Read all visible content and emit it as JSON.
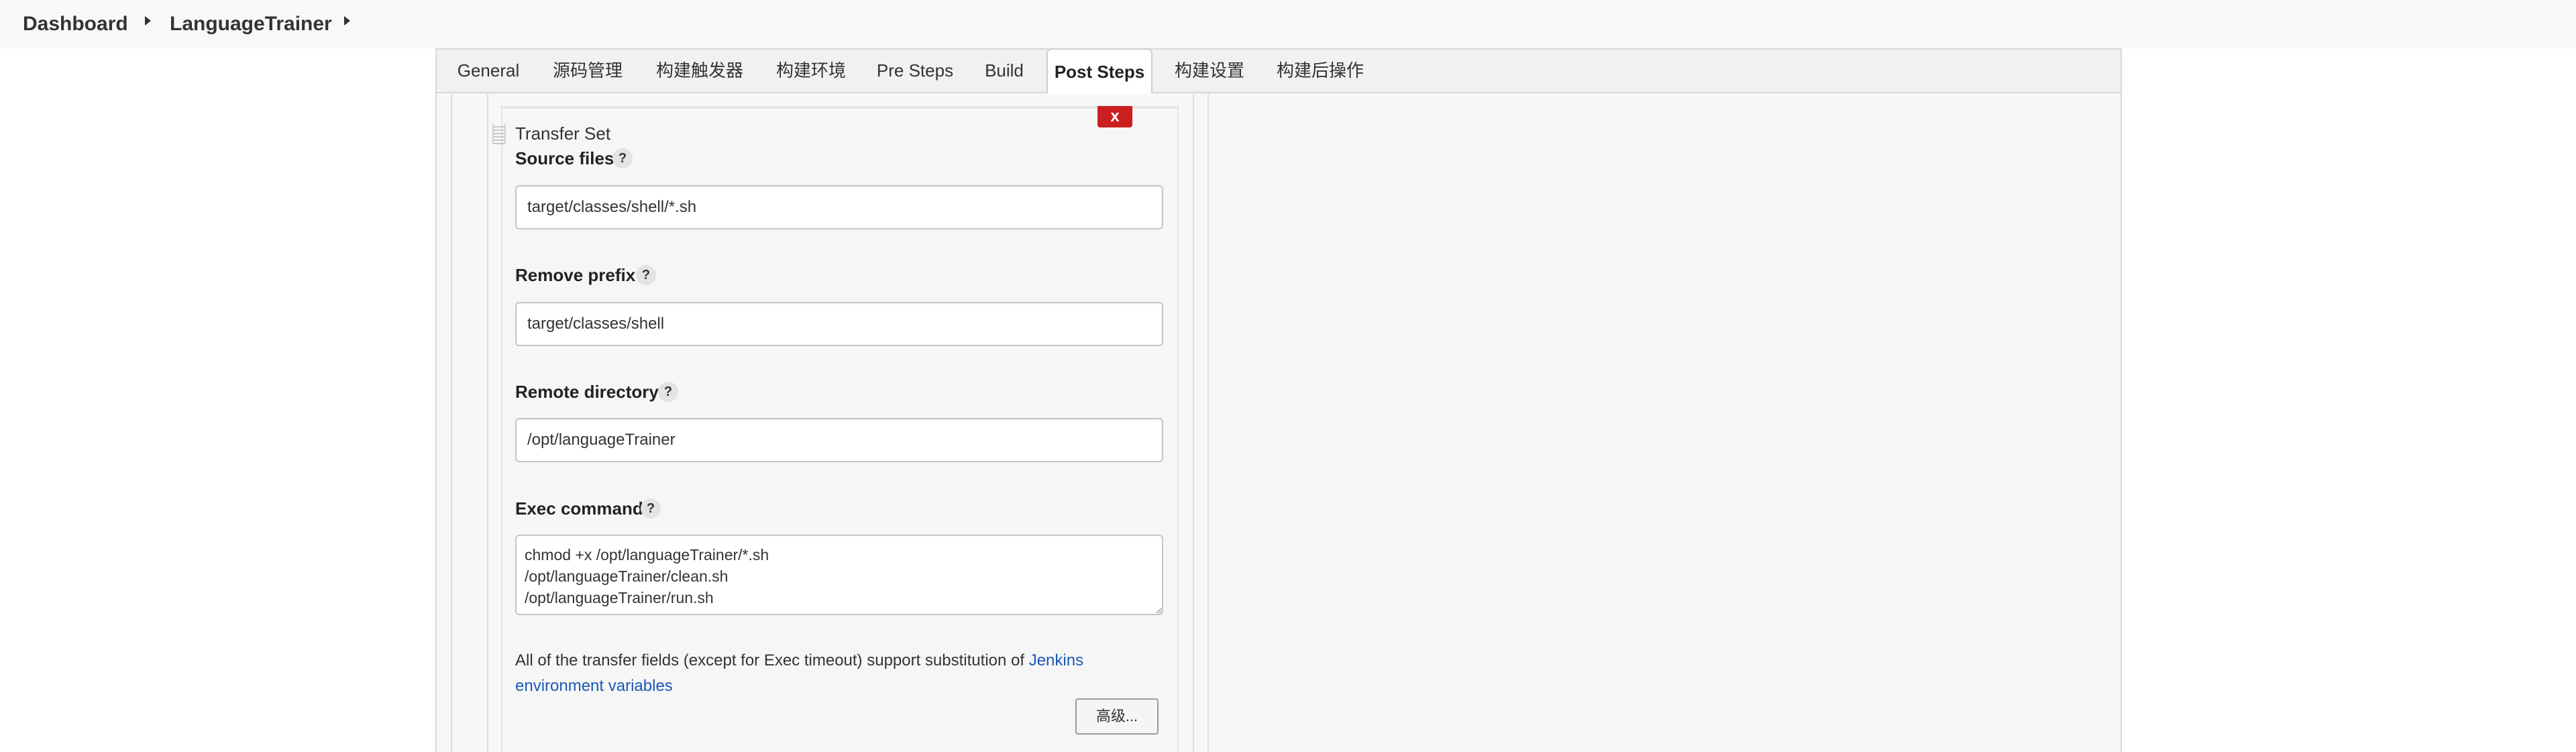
{
  "breadcrumb": {
    "items": [
      "Dashboard",
      "LanguageTrainer"
    ]
  },
  "tabs": [
    {
      "label": "General"
    },
    {
      "label": "源码管理"
    },
    {
      "label": "构建触发器"
    },
    {
      "label": "构建环境"
    },
    {
      "label": "Pre Steps"
    },
    {
      "label": "Build"
    },
    {
      "label": "Post Steps",
      "active": true
    },
    {
      "label": "构建设置"
    },
    {
      "label": "构建后操作"
    }
  ],
  "transfer_set": {
    "title": "Transfer Set",
    "delete_label": "x",
    "help_icon": "?",
    "source_files": {
      "label": "Source files",
      "value": "target/classes/shell/*.sh"
    },
    "remove_prefix": {
      "label": "Remove prefix",
      "value": "target/classes/shell"
    },
    "remote_directory": {
      "label": "Remote directory",
      "value": "/opt/languageTrainer"
    },
    "exec_command": {
      "label": "Exec command",
      "value": "chmod +x /opt/languageTrainer/*.sh\n/opt/languageTrainer/clean.sh\n/opt/languageTrainer/run.sh"
    },
    "note_text": "All of the transfer fields (except for Exec timeout) support substitution of ",
    "note_link": "Jenkins environment variables",
    "advanced_label": "高级..."
  },
  "colors": {
    "accent_link": "#1b58b8",
    "delete_red": "#cc1f1f"
  }
}
